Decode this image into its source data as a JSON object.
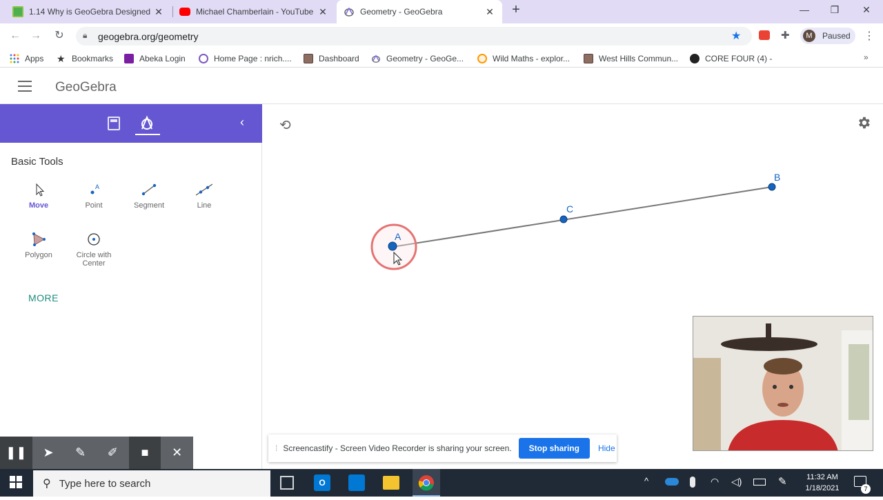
{
  "browser": {
    "tabs": [
      {
        "title": "1.14 Why is GeoGebra Designed",
        "icon": "geogebra-classroom-icon"
      },
      {
        "title": "Michael Chamberlain - YouTube",
        "icon": "youtube-icon"
      },
      {
        "title": "Geometry - GeoGebra",
        "icon": "geogebra-icon",
        "active": true
      }
    ],
    "url": "geogebra.org/geometry",
    "profile_initial": "M",
    "profile_status": "Paused",
    "bookmarks": [
      {
        "label": "Apps",
        "icon": "apps-grid-icon"
      },
      {
        "label": "Bookmarks",
        "icon": "star-icon"
      },
      {
        "label": "Abeka Login",
        "icon": "abeka-icon"
      },
      {
        "label": "Home Page : nrich....",
        "icon": "nrich-icon"
      },
      {
        "label": "Dashboard",
        "icon": "dashboard-icon"
      },
      {
        "label": "Geometry - GeoGe...",
        "icon": "geogebra-icon"
      },
      {
        "label": "Wild Maths - explor...",
        "icon": "wildmaths-icon"
      },
      {
        "label": "West Hills Commun...",
        "icon": "westhills-icon"
      },
      {
        "label": "CORE FOUR (4) -",
        "icon": "core-four-icon"
      }
    ]
  },
  "app": {
    "logo": "GeoGebra",
    "panel_title": "Basic Tools",
    "tools": [
      {
        "label": "Move",
        "icon": "move-cursor-icon",
        "selected": true
      },
      {
        "label": "Point",
        "icon": "point-tool-icon"
      },
      {
        "label": "Segment",
        "icon": "segment-tool-icon"
      },
      {
        "label": "Line",
        "icon": "line-tool-icon"
      },
      {
        "label": "Polygon",
        "icon": "polygon-tool-icon"
      },
      {
        "label": "Circle with Center",
        "icon": "circle-center-tool-icon"
      }
    ],
    "more_label": "MORE",
    "points": {
      "a": "A",
      "b": "B",
      "c": "C"
    }
  },
  "screencastify": {
    "share_message": "Screencastify - Screen Video Recorder is sharing your screen.",
    "stop_label": "Stop sharing",
    "hide_label": "Hide"
  },
  "taskbar": {
    "search_placeholder": "Type here to search",
    "time": "11:32 AM",
    "date": "1/18/2021",
    "notification_count": "7"
  },
  "colors": {
    "accent": "#6557d2",
    "point_blue": "#1565c0",
    "stop_button": "#1a73e8"
  }
}
